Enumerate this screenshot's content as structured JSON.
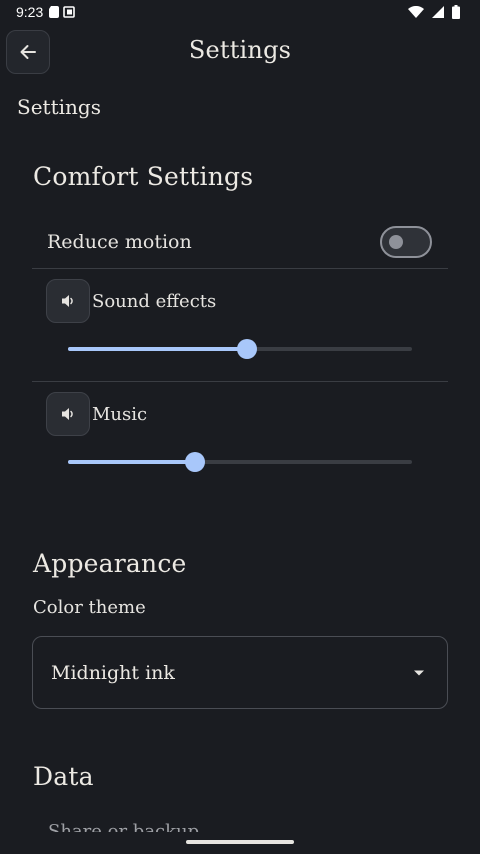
{
  "status_bar": {
    "time": "9:23",
    "icons": [
      "sd-card-icon",
      "screen-icon",
      "wifi-icon",
      "signal-icon",
      "battery-icon"
    ]
  },
  "top_bar": {
    "back_icon": "arrow-back-icon",
    "title": "Settings"
  },
  "subheading": "Settings",
  "comfort": {
    "title": "Comfort Settings",
    "reduce_motion": {
      "label": "Reduce motion",
      "enabled": false
    },
    "sound_effects": {
      "label": "Sound effects",
      "icon": "volume-icon",
      "value_percent": 52
    },
    "music": {
      "label": "Music",
      "icon": "volume-icon",
      "value_percent": 37
    }
  },
  "appearance": {
    "title": "Appearance",
    "color_theme_label": "Color theme",
    "color_theme_value": "Midnight ink"
  },
  "data": {
    "title": "Data",
    "first_item_partial": "Share or backup"
  },
  "colors": {
    "background": "#1a1c21",
    "accent": "#a8c7fa",
    "text": "#e6e4e0"
  }
}
